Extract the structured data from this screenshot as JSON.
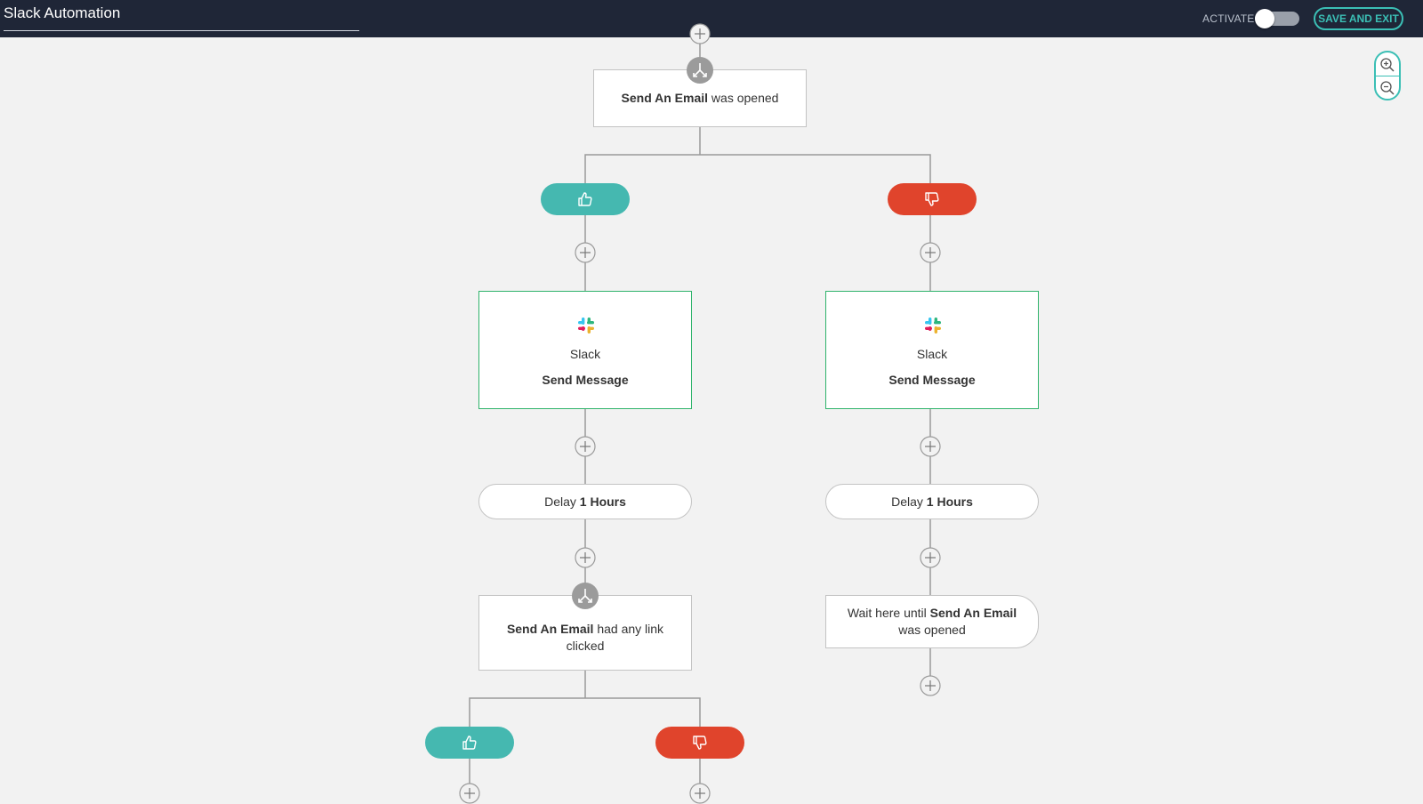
{
  "header": {
    "title": "Slack Automation",
    "activate_label": "ACTIVATE",
    "activate_state": "off",
    "save_label": "SAVE AND EXIT"
  },
  "colors": {
    "header_bg": "#1f2637",
    "accent": "#3bbfb5",
    "yes_branch": "#45b8b0",
    "no_branch": "#e0442c",
    "action_border": "#2fb36b"
  },
  "zoom": {
    "in_icon": "zoom-in-icon",
    "out_icon": "zoom-out-icon"
  },
  "flow": {
    "condition1": {
      "bold": "Send An Email",
      "rest": " was opened"
    },
    "yes_icon": "thumbs-up-icon",
    "no_icon": "thumbs-down-icon",
    "left": {
      "action": {
        "app": "Slack",
        "action": "Send Message"
      },
      "delay": {
        "prefix": "Delay ",
        "value": "1 Hours"
      },
      "condition": {
        "bold": "Send An Email",
        "rest": " had any link clicked"
      }
    },
    "right": {
      "action": {
        "app": "Slack",
        "action": "Send Message"
      },
      "delay": {
        "prefix": "Delay ",
        "value": "1 Hours"
      },
      "wait": {
        "prefix": "Wait here until ",
        "bold": "Send An Email",
        "rest": " was opened"
      }
    }
  }
}
